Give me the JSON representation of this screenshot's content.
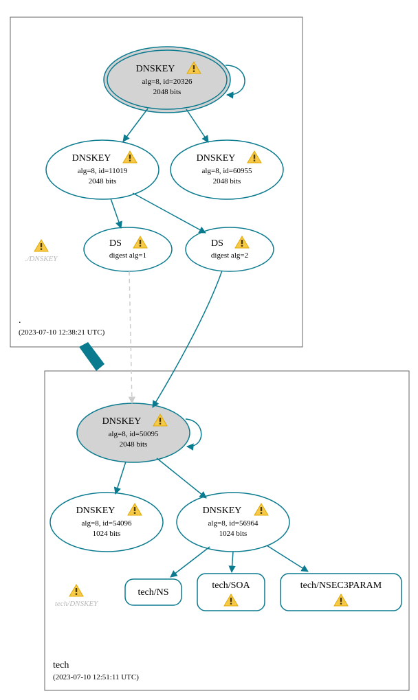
{
  "zones": {
    "root": {
      "name": ".",
      "time": "(2023-07-10 12:38:21 UTC)"
    },
    "tech": {
      "name": "tech",
      "time": "(2023-07-10 12:51:11 UTC)"
    }
  },
  "nodes": {
    "root_ksk": {
      "title": "DNSKEY",
      "l2": "alg=8, id=20326",
      "l3": "2048 bits"
    },
    "root_zsk1": {
      "title": "DNSKEY",
      "l2": "alg=8, id=11019",
      "l3": "2048 bits"
    },
    "root_zsk2": {
      "title": "DNSKEY",
      "l2": "alg=8, id=60955",
      "l3": "2048 bits"
    },
    "ds1": {
      "title": "DS",
      "l2": "digest alg=1"
    },
    "ds2": {
      "title": "DS",
      "l2": "digest alg=2"
    },
    "tech_ksk": {
      "title": "DNSKEY",
      "l2": "alg=8, id=50095",
      "l3": "2048 bits"
    },
    "tech_zsk1": {
      "title": "DNSKEY",
      "l2": "alg=8, id=54096",
      "l3": "1024 bits"
    },
    "tech_zsk2": {
      "title": "DNSKEY",
      "l2": "alg=8, id=56964",
      "l3": "1024 bits"
    },
    "r_ns": {
      "title": "tech/NS"
    },
    "r_soa": {
      "title": "tech/SOA"
    },
    "r_n3p": {
      "title": "tech/NSEC3PARAM"
    }
  },
  "ghosts": {
    "root": "./DNSKEY",
    "tech": "tech/DNSKEY"
  }
}
